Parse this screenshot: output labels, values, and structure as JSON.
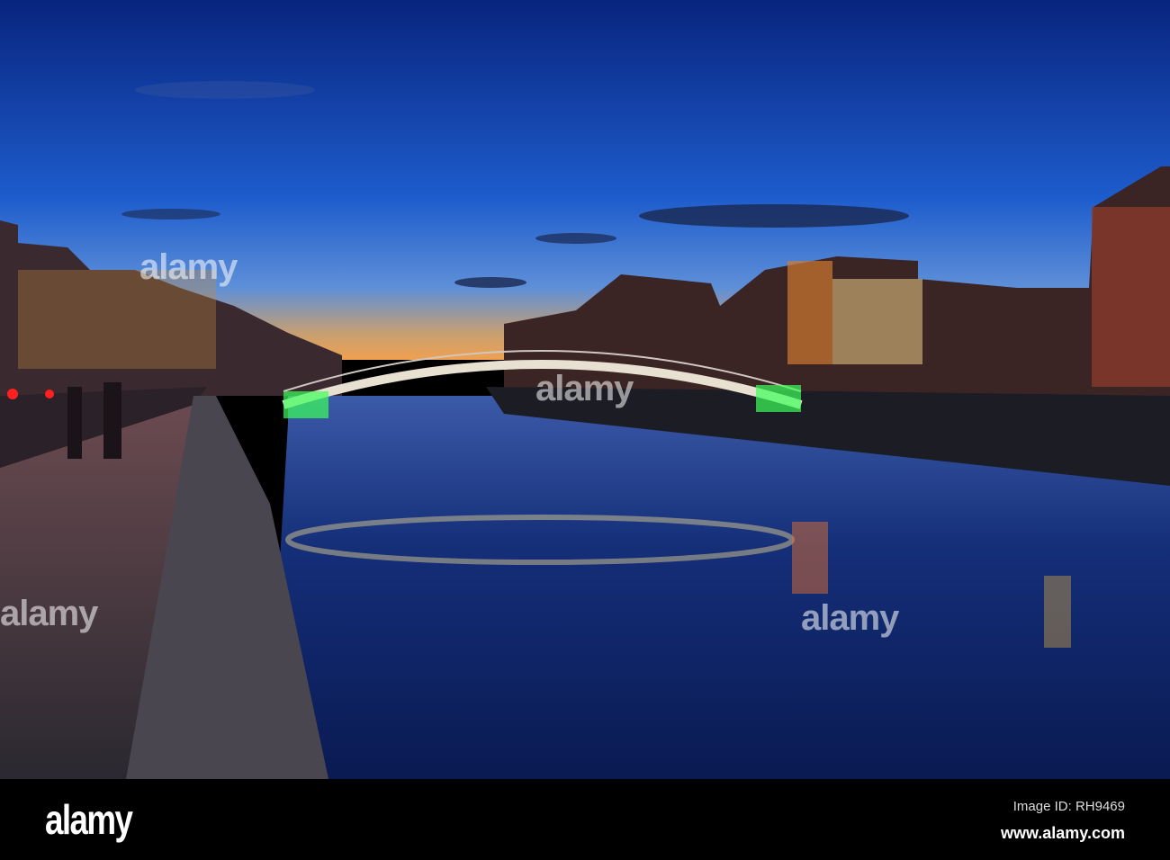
{
  "photo": {
    "watermark": "alamy",
    "colors": {
      "sky_top": "#0a2a8a",
      "sky_mid": "#1f5fd0",
      "horizon": "#f0a050",
      "water": "#0b1e5a",
      "bridge_light": "#3cff5a"
    }
  },
  "footer": {
    "logo": "alamy",
    "image_id": "Image ID: RH9469",
    "website": "www.alamy.com"
  }
}
